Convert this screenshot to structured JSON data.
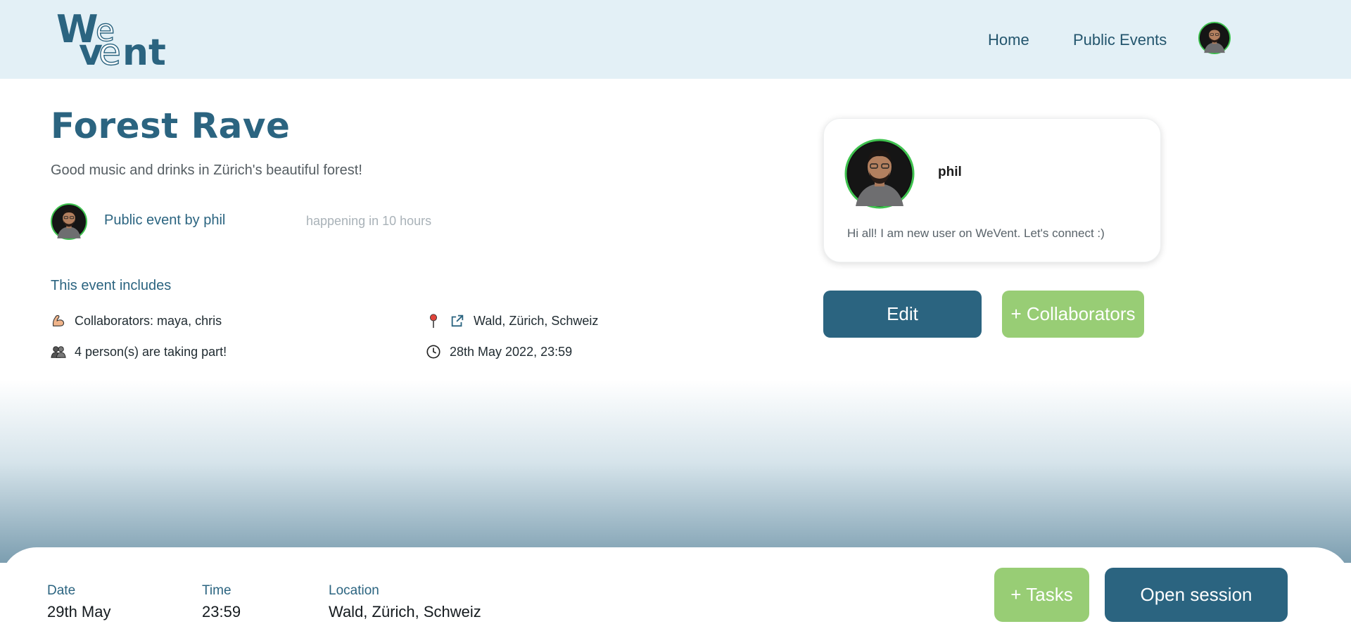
{
  "header": {
    "logo": {
      "top": "We",
      "bottom": "vent",
      "brand": "WeVent"
    },
    "nav": [
      {
        "label": "Home"
      },
      {
        "label": "Public Events"
      }
    ],
    "avatar_icon": "user-avatar-icon"
  },
  "event": {
    "title": "Forest Rave",
    "description": "Good music and drinks in Zürich's beautiful forest!",
    "owner_text": "Public event by phil",
    "status": "happening in 10 hours",
    "includes_heading": "This event includes",
    "collaborators": "Collaborators: maya, chris",
    "participants": "4 person(s) are taking part!",
    "location": "Wald, Zürich, Schweiz",
    "datetime": "28th May 2022, 23:59",
    "icons": {
      "collaborators": "flexed-biceps-icon",
      "participants": "people-icon",
      "location": "pin-icon",
      "external": "external-link-icon",
      "datetime": "clock-icon"
    }
  },
  "profile_card": {
    "name": "phil",
    "bio": "Hi all! I am new user on WeVent. Let's connect :)"
  },
  "actions": {
    "edit": "Edit",
    "collaborators": "+ Collaborators",
    "tasks": "+ Tasks",
    "open_session": "Open session"
  },
  "bottom_bar": {
    "date_label": "Date",
    "date_value": "29th May",
    "time_label": "Time",
    "time_value": "23:59",
    "location_label": "Location",
    "location_value": "Wald, Zürich, Schweiz"
  },
  "colors": {
    "primary": "#2b6480",
    "accent_green": "#98cd75",
    "header_bg": "#e3f0f6",
    "avatar_ring": "#3fc24f"
  }
}
